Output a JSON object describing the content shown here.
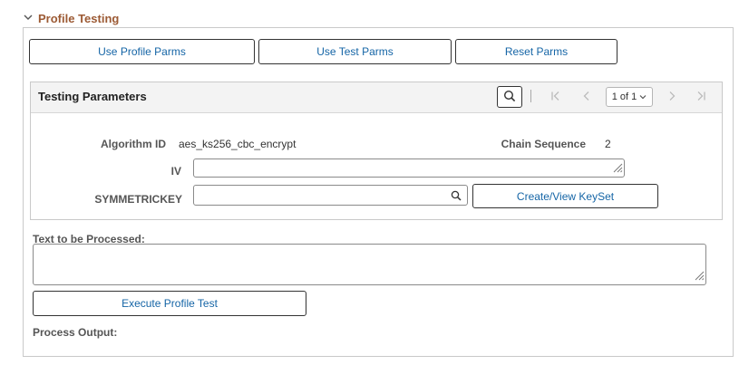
{
  "section": {
    "title": "Profile Testing"
  },
  "buttons": {
    "use_profile": "Use Profile Parms",
    "use_test": "Use Test Parms",
    "reset": "Reset Parms",
    "create_keyset": "Create/View KeySet",
    "execute": "Execute Profile Test"
  },
  "grid": {
    "title": "Testing Parameters",
    "pager": "1 of 1"
  },
  "fields": {
    "algorithm_label": "Algorithm ID",
    "algorithm_value": "aes_ks256_cbc_encrypt",
    "chain_label": "Chain Sequence",
    "chain_value": "2",
    "iv_label": "IV",
    "iv_value": "",
    "symkey_label": "SYMMETRICKEY",
    "symkey_value": ""
  },
  "text_to_process": {
    "label": "Text to be Processed:",
    "value": ""
  },
  "process_output": {
    "label": "Process Output:"
  },
  "colors": {
    "section_title": "#9c5a34",
    "link_blue": "#1565a6",
    "border": "#c9c9c9"
  }
}
